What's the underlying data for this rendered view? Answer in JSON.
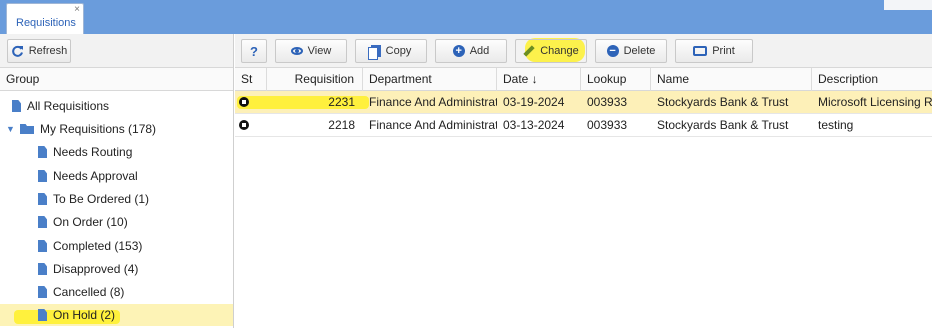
{
  "window": {
    "tab_label": "Requisitions",
    "tab_close": "×"
  },
  "left_panel": {
    "refresh_label": "Refresh",
    "group_header": "Group",
    "tree": [
      {
        "label": "All Requisitions",
        "icon": "document-icon"
      },
      {
        "label": "My Requisitions (178)",
        "icon": "folder-icon",
        "expanded": true
      },
      {
        "label": "Needs Routing",
        "icon": "document-icon"
      },
      {
        "label": "Needs Approval",
        "icon": "document-icon"
      },
      {
        "label": "To Be Ordered (1)",
        "icon": "document-icon"
      },
      {
        "label": "On Order (10)",
        "icon": "document-icon"
      },
      {
        "label": "Completed (153)",
        "icon": "document-icon"
      },
      {
        "label": "Disapproved (4)",
        "icon": "document-icon"
      },
      {
        "label": "Cancelled (8)",
        "icon": "document-icon"
      },
      {
        "label": "On Hold (2)",
        "icon": "document-icon",
        "selected": true
      }
    ]
  },
  "toolbar": {
    "help_label": "?",
    "view_label": "View",
    "copy_label": "Copy",
    "add_label": "Add",
    "change_label": "Change",
    "delete_label": "Delete",
    "print_label": "Print"
  },
  "grid": {
    "columns": [
      "St",
      "Requisition",
      "Department",
      "Date ↓",
      "Lookup",
      "Name",
      "Description"
    ],
    "rows": [
      {
        "requisition": "2231",
        "department": "Finance And Administration",
        "date": "03-19-2024",
        "lookup": "003933",
        "name": "Stockyards Bank & Trust",
        "description": "Microsoft Licensing Renewal",
        "selected": true
      },
      {
        "requisition": "2218",
        "department": "Finance And Administration",
        "date": "03-13-2024",
        "lookup": "003933",
        "name": "Stockyards Bank & Trust",
        "description": "testing",
        "selected": false
      }
    ]
  },
  "colors": {
    "topbar": "#6a9cdc",
    "accent": "#2d63b8",
    "highlight_marker": "#fff014",
    "selected_row": "#fdf0b8"
  }
}
